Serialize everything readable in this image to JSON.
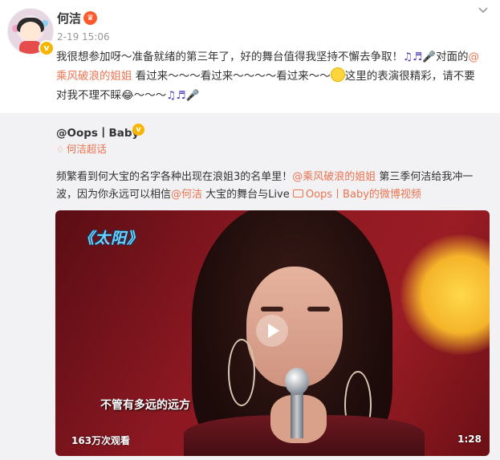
{
  "post": {
    "author": "何洁",
    "time": "2-19 15:06",
    "text_1": "我很想参加呀～准备就绪的第三年了，好的舞台值得我坚持不懈去争取！",
    "notes_1": "♫♬🎤",
    "text_2": "对面的",
    "mention_1": "@乘风破浪的姐姐",
    "text_3": " 看过来～～～看过来～～～～看过来～～",
    "text_4": "这里的表演很精彩，请不要对我不理不睬",
    "emoji_laugh": "😂",
    "text_5": "～～～",
    "notes_2": "♫♬🎤"
  },
  "repost": {
    "author": "@Oops丨Baby",
    "topic": "何洁超话",
    "text_1": "频繁看到何大宝的名字各种出现在浪姐3的名单里！",
    "mention_1": "@乘风破浪的姐姐",
    "text_2": " 第三季何洁给我冲一波，因为你永远可以相信",
    "mention_2": "@何洁",
    "text_3": " 大宝的舞台与Live ",
    "video_link": "Oops丨Baby的微博视频"
  },
  "video": {
    "title_overlay": "《太阳》",
    "subtitle": "不管有多远的远方",
    "views": "163万次观看",
    "duration": "1:28"
  },
  "icons": {
    "verified": "v-badge-icon",
    "member": "member-crown-icon",
    "menu": "chevron-down-icon",
    "topic": "diamond-icon",
    "play": "play-icon",
    "video_link": "video-camera-icon"
  },
  "colors": {
    "link": "#eb7350",
    "verified": "#f7b500",
    "repost_bg": "#f2f2f5"
  }
}
